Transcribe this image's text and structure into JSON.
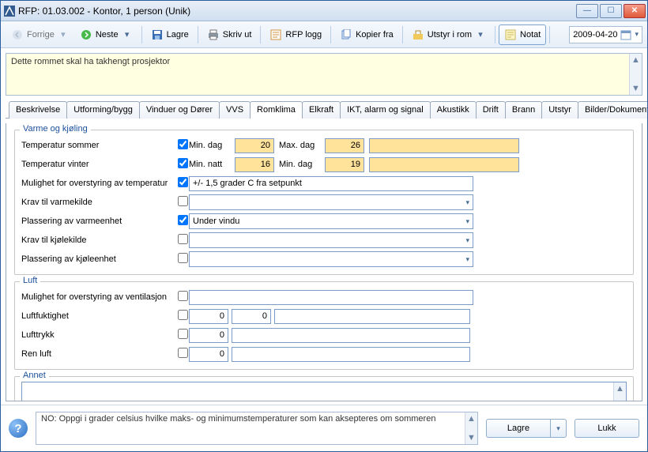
{
  "window": {
    "title": "RFP: 01.03.002 - Kontor, 1 person (Unik)"
  },
  "toolbar": {
    "prev": "Forrige",
    "next": "Neste",
    "save": "Lagre",
    "print": "Skriv ut",
    "rfplog": "RFP logg",
    "copyfrom": "Kopier fra",
    "equip": "Utstyr i rom",
    "note": "Notat",
    "date": "2009-04-20"
  },
  "note": "Dette rommet skal ha takhengt prosjektor",
  "tabs": [
    "Beskrivelse",
    "Utforming/bygg",
    "Vinduer og Dører",
    "VVS",
    "Romklima",
    "Elkraft",
    "IKT, alarm og signal",
    "Akustikk",
    "Drift",
    "Brann",
    "Utstyr",
    "Bilder/Dokumenter"
  ],
  "heat": {
    "legend": "Varme og kjøling",
    "tempSummer": "Temperatur sommer",
    "tempWinter": "Temperatur vinter",
    "minDag": "Min. dag",
    "maxDag": "Max. dag",
    "minNatt": "Min. natt",
    "minDag2": "Min. dag",
    "vSummerMin": "20",
    "vSummerMax": "26",
    "vWinterNatt": "16",
    "vWinterDag": "19",
    "override": "Mulighet for overstyring av temperatur",
    "overrideVal": "+/- 1,5 grader C fra setpunkt",
    "heatsrc": "Krav til varmekilde",
    "heatloc": "Plassering av varmeenhet",
    "heatlocVal": "Under vindu",
    "coolsrc": "Krav til kjølekilde",
    "coolloc": "Plassering av kjøleenhet"
  },
  "air": {
    "legend": "Luft",
    "ventOverride": "Mulighet for overstyring av ventilasjon",
    "humidity": "Luftfuktighet",
    "hum1": "0",
    "hum2": "0",
    "pressure": "Lufttrykk",
    "press1": "0",
    "clean": "Ren luft",
    "clean1": "0"
  },
  "annet": {
    "legend": "Annet"
  },
  "footer": {
    "hint": "NO: Oppgi i grader celsius hvilke maks- og minimumstemperaturer som kan aksepteres om sommeren",
    "save": "Lagre",
    "close": "Lukk"
  }
}
